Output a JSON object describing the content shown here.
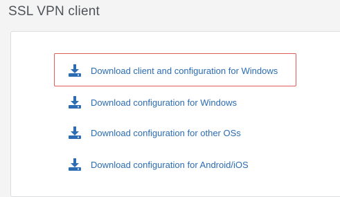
{
  "page": {
    "title": "SSL VPN client"
  },
  "downloads": [
    {
      "label": "Download client and configuration for Windows",
      "icon": "download-icon",
      "highlighted": true
    },
    {
      "label": "Download configuration for Windows",
      "icon": "download-icon",
      "highlighted": false
    },
    {
      "label": "Download configuration for other OSs",
      "icon": "download-icon",
      "highlighted": false
    },
    {
      "label": "Download configuration for Android/iOS",
      "icon": "download-icon",
      "highlighted": false
    }
  ],
  "colors": {
    "link": "#2b6cb3",
    "icon": "#2b6cb3",
    "highlight_border": "#e05c5c",
    "title": "#4f5358",
    "background": "#f4f4f5",
    "panel": "#ffffff"
  }
}
